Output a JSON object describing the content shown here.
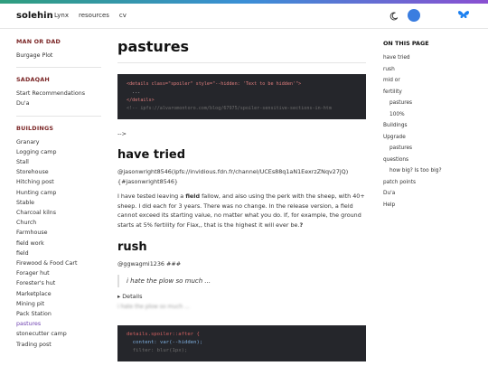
{
  "header": {
    "brand": "solehin",
    "nav": [
      "Lynx",
      "resources",
      "cv"
    ]
  },
  "sidebar": {
    "sections": [
      {
        "title": "MAN OR DAD",
        "items": [
          "Burgage Plot"
        ]
      },
      {
        "title": "SADAQAH",
        "items": [
          "Start Recommendations",
          "Du'a"
        ]
      },
      {
        "title": "BUILDINGS",
        "items": [
          "Granary",
          "Logging camp",
          "Stall",
          "Storehouse",
          "Hitching post",
          "Hunting camp",
          "Stable",
          "Charcoal kilns",
          "Church",
          "Farmhouse",
          "field work",
          "field",
          "Firewood & Food Cart",
          "Forager hut",
          "Forester's hut",
          "Marketplace",
          "Mining pit",
          "Pack Station",
          "pastures",
          "stonecutter camp",
          "Trading post"
        ]
      }
    ],
    "active": "pastures"
  },
  "main": {
    "title": "pastures",
    "code1": [
      "<details class=\"spoiler\" style=\"--hidden: 'Text to be hidden'\">",
      "  ...",
      "</details>",
      "<!-- ipfs://alvaromontoro.com/blog/67975/spoiler-sensitive-sections-in-htm"
    ],
    "arrow_text": "-->",
    "section1_title": "have tried",
    "section1_link": "@jasonwright8546(ipfs://invidious.fdn.fr/channel/UCEs88q1aN1EexrzZNqv27jQ) {#jasonwright8546}",
    "section1_para_a": "I have tested leaving a ",
    "section1_para_bold": "field",
    "section1_para_b": " fallow, and also using the perk with the sheep, with 40+ sheep. I did each for 3 years. There was no change. In the release version, a field cannot exceed its starting value, no matter what you do. If, for example, the ground starts at 5% fertility for Flax,, that is the highest it will ever be.",
    "section1_para_end": "?",
    "section2_title": "rush",
    "section2_handle": "@ggwagmi1236 ###",
    "quote": "i hate the plow so much ...",
    "details_label": "Details",
    "blurred_text": "i hate the plow so much ...",
    "code2": [
      "details.spoiler::after {",
      "  content: var(--hidden);",
      "  filter: blur(1px);"
    ]
  },
  "toc": {
    "heading": "ON THIS PAGE",
    "items": [
      {
        "label": "have tried",
        "sub": false
      },
      {
        "label": "rush",
        "sub": false
      },
      {
        "label": "mid or",
        "sub": false
      },
      {
        "label": "fertility",
        "sub": false
      },
      {
        "label": "pastures",
        "sub": true
      },
      {
        "label": "100%",
        "sub": true
      },
      {
        "label": "Buildings",
        "sub": false
      },
      {
        "label": "Upgrade",
        "sub": false
      },
      {
        "label": "pastures",
        "sub": true
      },
      {
        "label": "questions",
        "sub": false
      },
      {
        "label": "how big? Is too big?",
        "sub": true
      },
      {
        "label": "patch points",
        "sub": false
      },
      {
        "label": "Du'a",
        "sub": false
      },
      {
        "label": "Help",
        "sub": false
      }
    ]
  },
  "colors": {
    "accent": "#6d3fb0",
    "section_heading": "#7a2525",
    "code_bg": "#25262b",
    "avatar": "#3a7de0",
    "butterfly": "#1a7ff0"
  },
  "icons": [
    "moon-icon",
    "avatar-icon",
    "butterfly-icon"
  ]
}
